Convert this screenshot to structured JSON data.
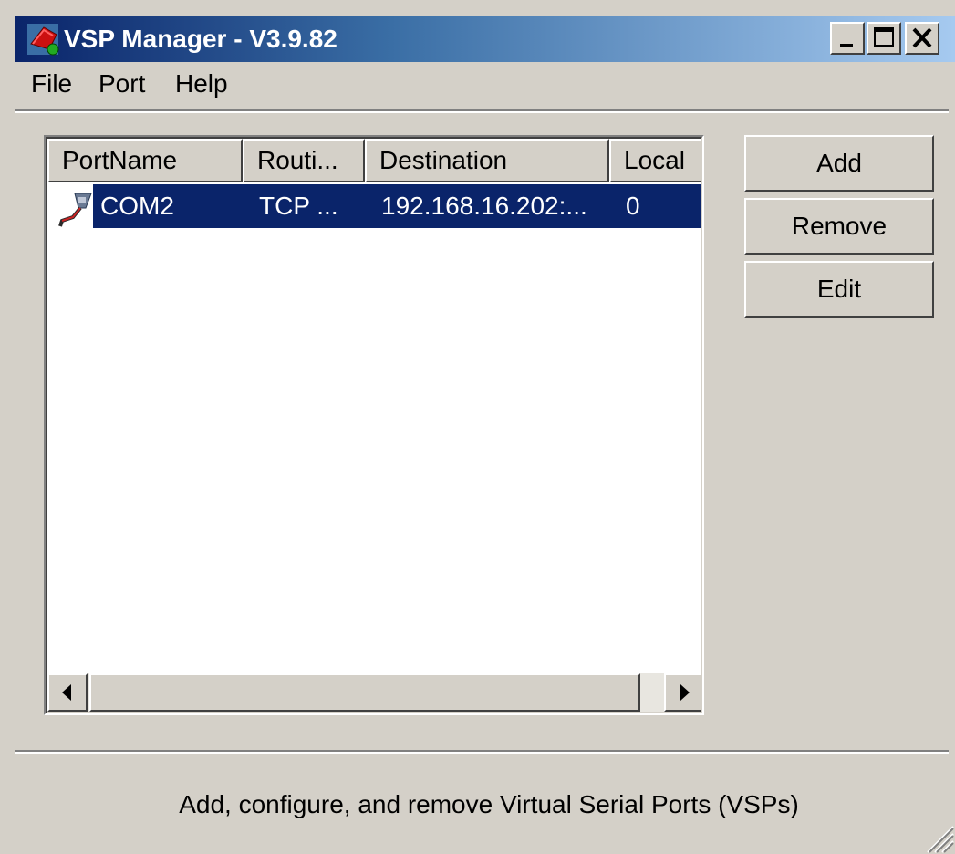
{
  "window": {
    "title": "VSP Manager - V3.9.82",
    "controls": [
      "minimize",
      "maximize",
      "close"
    ]
  },
  "menu": {
    "items": [
      "File",
      "Port",
      "Help"
    ]
  },
  "list": {
    "columns": [
      "PortName",
      "Routi...",
      "Destination",
      "Local"
    ],
    "rows": [
      {
        "port_name": "COM2",
        "routing": "TCP ...",
        "destination": "192.168.16.202:...",
        "local": "0",
        "selected": true,
        "icon": "serial-port-icon"
      }
    ]
  },
  "actions": {
    "add": "Add",
    "remove": "Remove",
    "edit": "Edit"
  },
  "status": {
    "text": "Add, configure, and remove Virtual Serial Ports (VSPs)"
  },
  "colors": {
    "selection": "#0a246a",
    "face": "#d4d0c8",
    "title_start": "#0a246a",
    "title_end": "#a6caf0"
  }
}
